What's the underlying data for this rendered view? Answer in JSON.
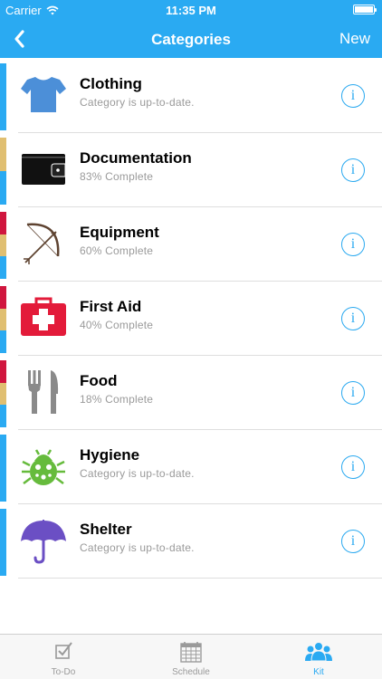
{
  "status": {
    "carrier": "Carrier",
    "time": "11:35 PM",
    "battery_level": 1.0
  },
  "nav": {
    "title": "Categories",
    "back_icon": "chevron-left-icon",
    "right_label": "New"
  },
  "categories": [
    {
      "title": "Clothing",
      "subtitle": "Category is up-to-date.",
      "icon": "tshirt-icon",
      "stripe": [
        "#2aaaf2"
      ]
    },
    {
      "title": "Documentation",
      "subtitle": "83% Complete",
      "icon": "wallet-icon",
      "stripe": [
        "#e0bf71",
        "#2aaaf2"
      ]
    },
    {
      "title": "Equipment",
      "subtitle": "60% Complete",
      "icon": "bow-arrow-icon",
      "stripe": [
        "#d0163e",
        "#e0bf71",
        "#2aaaf2"
      ]
    },
    {
      "title": "First Aid",
      "subtitle": "40% Complete",
      "icon": "first-aid-kit-icon",
      "stripe": [
        "#d0163e",
        "#e0bf71",
        "#2aaaf2"
      ]
    },
    {
      "title": "Food",
      "subtitle": "18% Complete",
      "icon": "fork-knife-icon",
      "stripe": [
        "#d0163e",
        "#e0bf71",
        "#2aaaf2"
      ]
    },
    {
      "title": "Hygiene",
      "subtitle": "Category is up-to-date.",
      "icon": "bug-icon",
      "stripe": [
        "#2aaaf2"
      ]
    },
    {
      "title": "Shelter",
      "subtitle": "Category is up-to-date.",
      "icon": "umbrella-icon",
      "stripe": [
        "#2aaaf2"
      ]
    }
  ],
  "tabs": [
    {
      "label": "To-Do",
      "icon": "checkbox-icon",
      "active": false
    },
    {
      "label": "Schedule",
      "icon": "calendar-icon",
      "active": false
    },
    {
      "label": "Kit",
      "icon": "people-icon",
      "active": true
    }
  ],
  "colors": {
    "accent": "#2aaaf2",
    "red": "#d0163e",
    "gold": "#e0bf71"
  }
}
